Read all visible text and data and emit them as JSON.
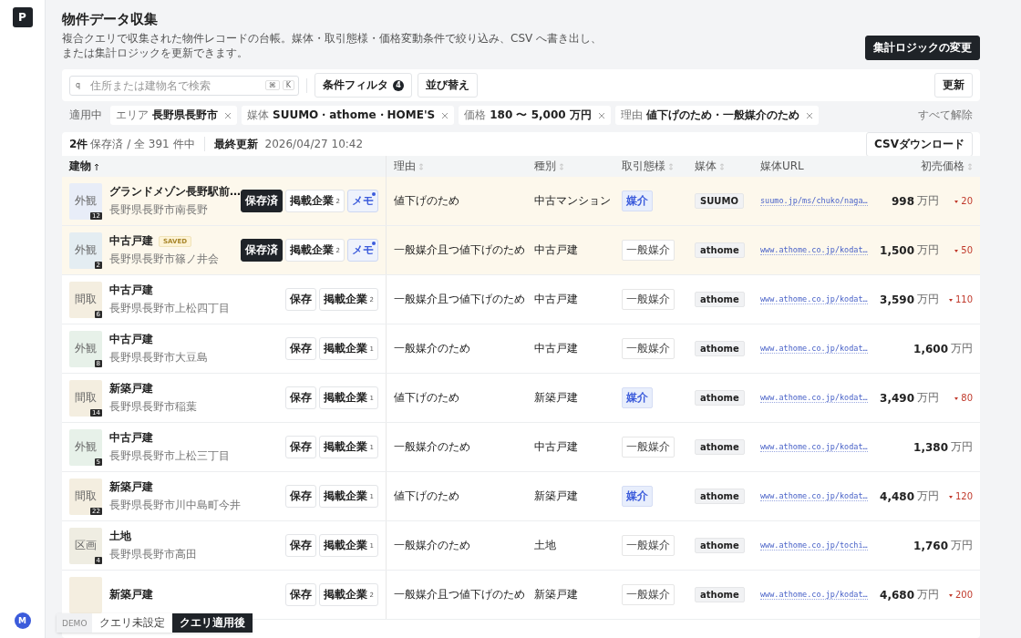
{
  "sidebar": {
    "logo": "P",
    "avatar": "M"
  },
  "header": {
    "title": "物件データ収集",
    "description": "複合クエリで収集された物件レコードの台帳。媒体・取引態様・価格変動条件で絞り込み、CSV へ書き出し、または集計ロジックを更新できます。",
    "action": "集計ロジックの変更"
  },
  "toolbar": {
    "search": {
      "glyph": "q",
      "placeholder": "住所または建物名で検索",
      "keys": [
        "⌘",
        "K"
      ]
    },
    "filter": {
      "label": "条件フィルタ",
      "count": "4"
    },
    "sort": "並び替え",
    "refresh": "更新"
  },
  "filters": {
    "label": "適用中",
    "chips": [
      {
        "key": "エリア",
        "value": "長野県長野市"
      },
      {
        "key": "媒体",
        "value": "SUUMO・athome・HOME'S"
      },
      {
        "key": "価格",
        "value": "180 〜 5,000 万円"
      },
      {
        "key": "理由",
        "value": "値下げのため・一般媒介のため"
      }
    ],
    "clear": "すべて解除"
  },
  "table": {
    "summary_count": "2件",
    "summary_rest": "保存済 / 全 391 件中",
    "updated_label": "最終更新",
    "updated": "2026/04/27 10:42",
    "download": "CSVダウンロード",
    "columns": [
      {
        "label": "建物",
        "sortable": true,
        "sorted": true
      },
      {
        "label": "理由",
        "sortable": true,
        "sorted": false
      },
      {
        "label": "種別",
        "sortable": true,
        "sorted": false
      },
      {
        "label": "取引態様",
        "sortable": true,
        "sorted": false
      },
      {
        "label": "媒体",
        "sortable": true,
        "sorted": false
      },
      {
        "label": "媒体URL",
        "sortable": false,
        "sorted": false
      },
      {
        "label": "初売価格",
        "sortable": true,
        "sorted": false
      }
    ],
    "rows": [
      {
        "thumb": {
          "label": "外観",
          "count": "12",
          "color": "#e8edf8"
        },
        "name": "グランドメゾン長野駅前…",
        "address": "長野県長野市南長野",
        "saved": true,
        "save_label": "保存済",
        "companies": "掲載企業",
        "company_count": "2",
        "memo": {
          "label": "メモ",
          "has_note": true
        },
        "reason": "値下げのため",
        "type": "中古マンション",
        "deal": {
          "label": "媒介",
          "kind": "exclusive"
        },
        "media": "SUUMO",
        "url": "suumo.jp/ms/chuko/naga…",
        "price": "998",
        "unit": "万円",
        "change": "20"
      },
      {
        "thumb": {
          "label": "外観",
          "count": "2",
          "color": "#e4edf2"
        },
        "name": "中古戸建",
        "badge": "SAVED",
        "address": "長野県長野市篠ノ井会",
        "saved": true,
        "save_label": "保存済",
        "companies": "掲載企業",
        "company_count": "2",
        "memo": {
          "label": "メモ",
          "has_note": true
        },
        "reason": "一般媒介且つ値下げのため",
        "type": "中古戸建",
        "deal": {
          "label": "一般媒介",
          "kind": "general"
        },
        "media": "athome",
        "url": "www.athome.co.jp/kodat…",
        "price": "1,500",
        "unit": "万円",
        "change": "50"
      },
      {
        "thumb": {
          "label": "間取",
          "count": "6",
          "color": "#f4eee0"
        },
        "name": "中古戸建",
        "address": "長野県長野市上松四丁目",
        "saved": false,
        "save_label": "保存",
        "companies": "掲載企業",
        "company_count": "2",
        "reason": "一般媒介且つ値下げのため",
        "type": "中古戸建",
        "deal": {
          "label": "一般媒介",
          "kind": "general"
        },
        "media": "athome",
        "url": "www.athome.co.jp/kodat…",
        "price": "3,590",
        "unit": "万円",
        "change": "110"
      },
      {
        "thumb": {
          "label": "外観",
          "count": "8",
          "color": "#e7f1e9"
        },
        "name": "中古戸建",
        "address": "長野県長野市大豆島",
        "saved": false,
        "save_label": "保存",
        "companies": "掲載企業",
        "company_count": "1",
        "reason": "一般媒介のため",
        "type": "中古戸建",
        "deal": {
          "label": "一般媒介",
          "kind": "general"
        },
        "media": "athome",
        "url": "www.athome.co.jp/kodat…",
        "price": "1,600",
        "unit": "万円"
      },
      {
        "thumb": {
          "label": "間取",
          "count": "14",
          "color": "#f4eee0"
        },
        "name": "新築戸建",
        "address": "長野県長野市稲葉",
        "saved": false,
        "save_label": "保存",
        "companies": "掲載企業",
        "company_count": "1",
        "reason": "値下げのため",
        "type": "新築戸建",
        "deal": {
          "label": "媒介",
          "kind": "exclusive"
        },
        "media": "athome",
        "url": "www.athome.co.jp/kodat…",
        "price": "3,490",
        "unit": "万円",
        "change": "80"
      },
      {
        "thumb": {
          "label": "外観",
          "count": "5",
          "color": "#e7f1e9"
        },
        "name": "中古戸建",
        "address": "長野県長野市上松三丁目",
        "saved": false,
        "save_label": "保存",
        "companies": "掲載企業",
        "company_count": "1",
        "reason": "一般媒介のため",
        "type": "中古戸建",
        "deal": {
          "label": "一般媒介",
          "kind": "general"
        },
        "media": "athome",
        "url": "www.athome.co.jp/kodat…",
        "price": "1,380",
        "unit": "万円"
      },
      {
        "thumb": {
          "label": "間取",
          "count": "22",
          "color": "#f4eee0"
        },
        "name": "新築戸建",
        "address": "長野県長野市川中島町今井",
        "saved": false,
        "save_label": "保存",
        "companies": "掲載企業",
        "company_count": "1",
        "reason": "値下げのため",
        "type": "新築戸建",
        "deal": {
          "label": "媒介",
          "kind": "exclusive"
        },
        "media": "athome",
        "url": "www.athome.co.jp/kodat…",
        "price": "4,480",
        "unit": "万円",
        "change": "120"
      },
      {
        "thumb": {
          "label": "区画",
          "count": "4",
          "color": "#efede2"
        },
        "name": "土地",
        "address": "長野県長野市高田",
        "saved": false,
        "save_label": "保存",
        "companies": "掲載企業",
        "company_count": "1",
        "reason": "一般媒介のため",
        "type": "土地",
        "deal": {
          "label": "一般媒介",
          "kind": "general"
        },
        "media": "athome",
        "url": "www.athome.co.jp/tochi…",
        "price": "1,760",
        "unit": "万円"
      },
      {
        "thumb": {
          "color": "#f4eee0"
        },
        "name": "新築戸建",
        "saved": false,
        "save_label": "保存",
        "companies": "掲載企業",
        "company_count": "2",
        "reason": "一般媒介且つ値下げのため",
        "type": "新築戸建",
        "deal": {
          "label": "一般媒介",
          "kind": "general"
        },
        "media": "athome",
        "url": "www.athome.co.jp/kodat…",
        "price": "4,680",
        "unit": "万円",
        "change": "200"
      }
    ]
  },
  "demo_bar": {
    "label": "DEMO",
    "options": [
      {
        "label": "クエリ未設定",
        "selected": false
      },
      {
        "label": "クエリ適用後",
        "selected": true
      }
    ]
  }
}
